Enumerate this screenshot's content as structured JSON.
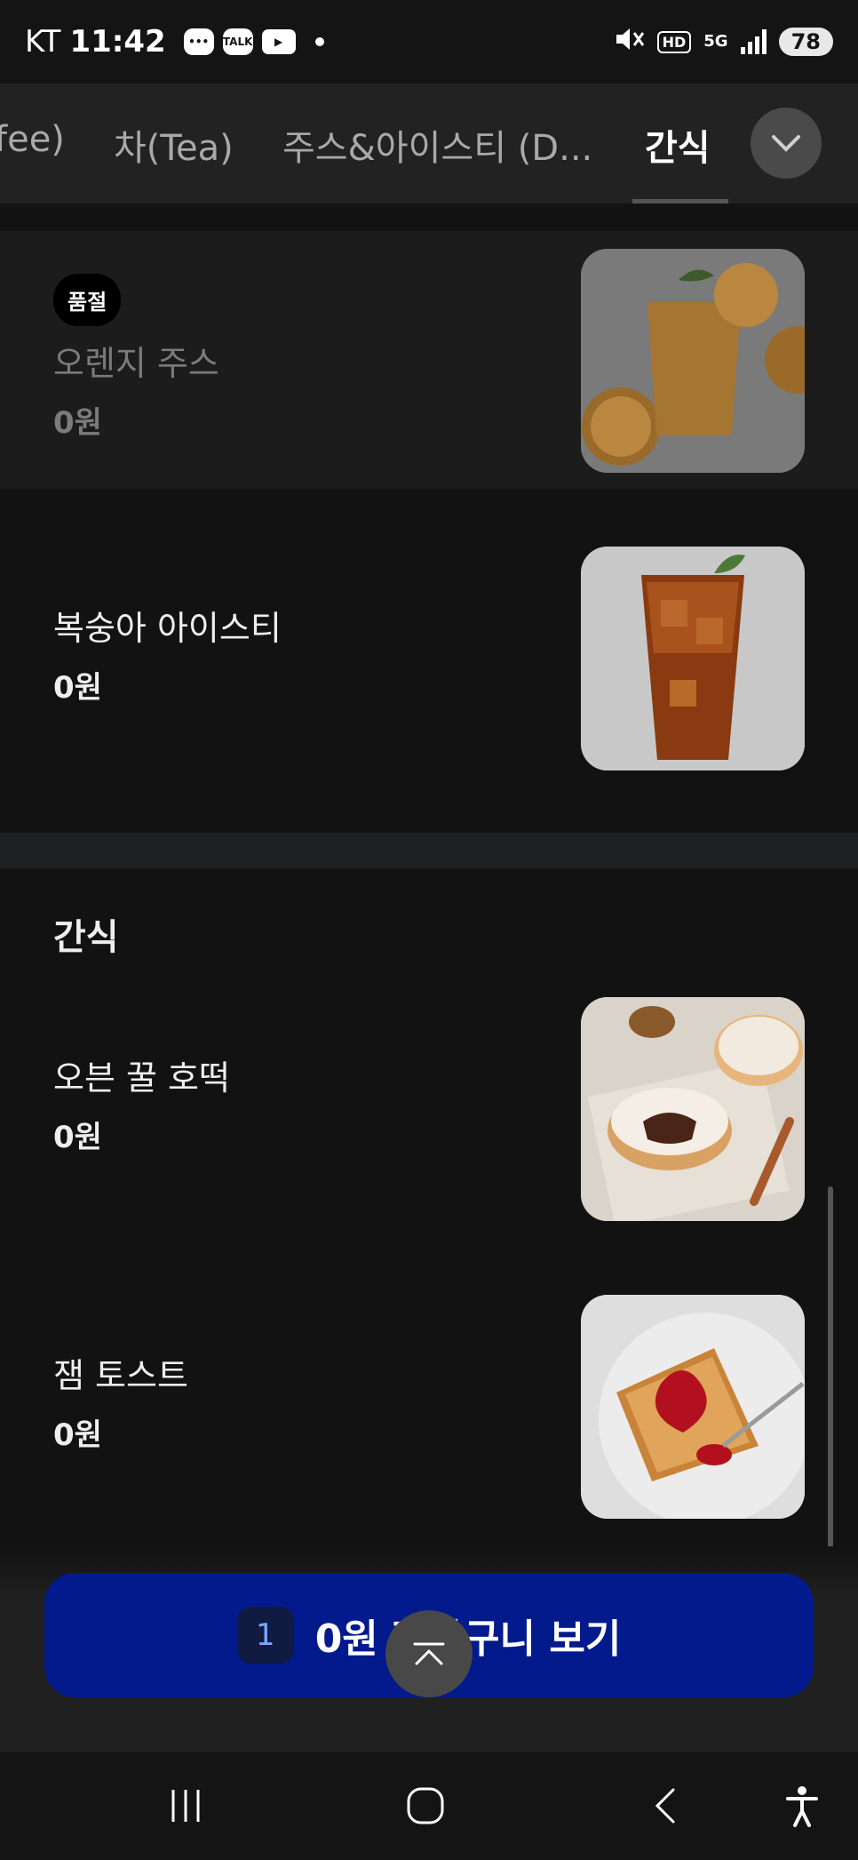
{
  "status_bar": {
    "carrier": "KT",
    "time": "11:42",
    "notif_talk": "TALK",
    "hd": "HD",
    "network": "5G",
    "battery": "78"
  },
  "tabs": [
    {
      "label": "fee)"
    },
    {
      "label": "차(Tea)"
    },
    {
      "label": "주스&아이스티 (D..."
    },
    {
      "label": "간식"
    }
  ],
  "items": [
    {
      "name": "오렌지 주스",
      "price": "0원",
      "badge": "품절"
    },
    {
      "name": "복숭아 아이스티",
      "price": "0원"
    },
    {
      "name": "오븐 꿀 호떡",
      "price": "0원"
    },
    {
      "name": "잼 토스트",
      "price": "0원"
    }
  ],
  "section": {
    "title": "간식"
  },
  "cart": {
    "count": "1",
    "label": "0원 장바구니 보기"
  },
  "icons": {
    "tab_more": "chevron-down-icon",
    "scroll_top": "chevron-up-icon",
    "nav_recent": "recent-apps-icon",
    "nav_home": "home-icon",
    "nav_back": "back-icon",
    "nav_accessibility": "accessibility-icon"
  },
  "colors": {
    "cart_button": "#021a8c",
    "background": "#121212"
  }
}
